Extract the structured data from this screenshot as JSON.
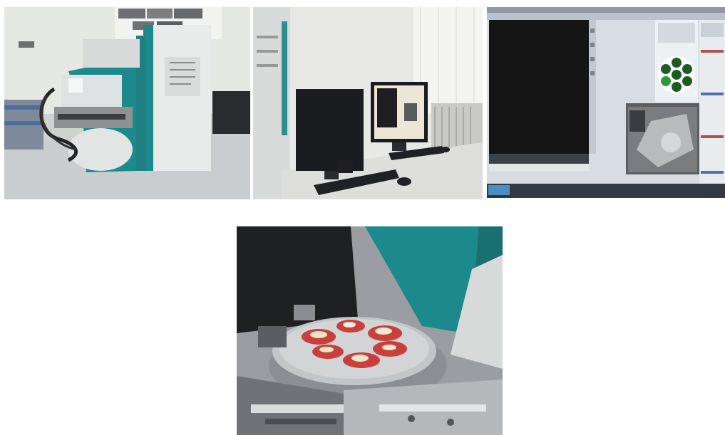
{
  "figure": {
    "panels": [
      {
        "subject": "sem-microscope-side-view"
      },
      {
        "subject": "workstation-with-monitors"
      },
      {
        "subject": "sem-software-screen"
      },
      {
        "subject": "sample-stage-with-specimens"
      }
    ],
    "colors": {
      "instrument_teal": "#1c8a8c",
      "instrument_white": "#e9ebea",
      "screen_black": "#151515",
      "specimen_red": "#c7403c",
      "nav_green": "#2f9a3a"
    }
  }
}
